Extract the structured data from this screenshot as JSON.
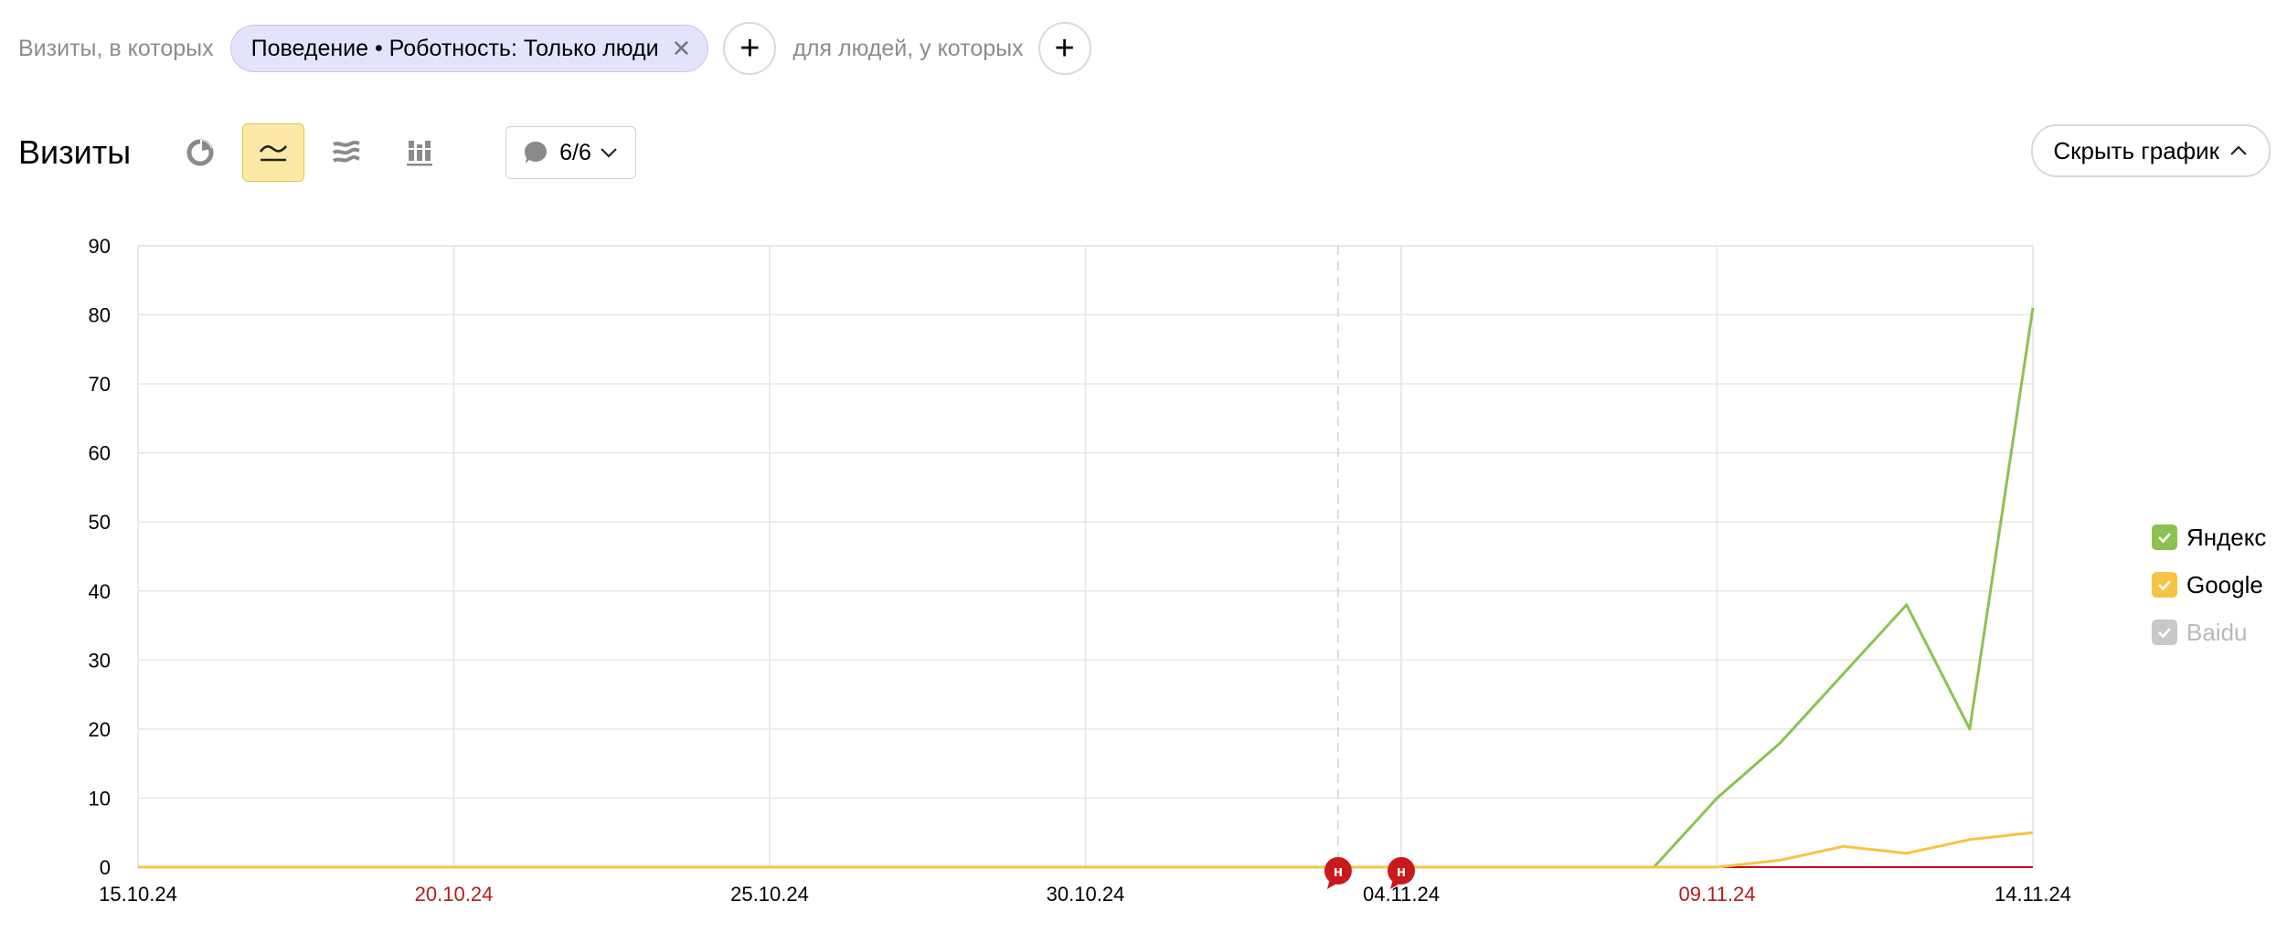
{
  "filters": {
    "visits_label": "Визиты, в которых",
    "chip_label": "Поведение • Роботность: Только люди",
    "add_symbol": "+",
    "people_label": "для людей, у которых"
  },
  "toolbar": {
    "title": "Визиты",
    "annotations_label": "6/6",
    "hide_chart_label": "Скрыть график"
  },
  "colors": {
    "yandex": "#8cc152",
    "google": "#f6c445",
    "baidu": "#c8c8c8",
    "axis_zero": "#d0021b",
    "holiday_label": "#b31b1b",
    "marker": "#c8191d"
  },
  "chart_data": {
    "type": "line",
    "x_ticks": [
      "15.10.24",
      "20.10.24",
      "25.10.24",
      "30.10.24",
      "04.11.24",
      "09.11.24",
      "14.11.24"
    ],
    "x_tick_holiday": [
      false,
      true,
      false,
      false,
      false,
      true,
      false
    ],
    "x_start": "15.10.24",
    "x_end": "14.11.24",
    "ylim": [
      0,
      90
    ],
    "y_ticks": [
      0,
      10,
      20,
      30,
      40,
      50,
      60,
      70,
      80,
      90
    ],
    "grid": true,
    "legend_position": "right",
    "series": [
      {
        "name": "Яндекс",
        "color_key": "yandex",
        "enabled": true,
        "points": [
          [
            "15.10.24",
            0
          ],
          [
            "08.11.24",
            0
          ],
          [
            "09.11.24",
            10
          ],
          [
            "10.11.24",
            18
          ],
          [
            "11.11.24",
            28
          ],
          [
            "12.11.24",
            38
          ],
          [
            "13.11.24",
            20
          ],
          [
            "14.11.24",
            81
          ]
        ]
      },
      {
        "name": "Google",
        "color_key": "google",
        "enabled": true,
        "points": [
          [
            "15.10.24",
            0
          ],
          [
            "09.11.24",
            0
          ],
          [
            "10.11.24",
            1
          ],
          [
            "11.11.24",
            3
          ],
          [
            "12.11.24",
            2
          ],
          [
            "13.11.24",
            4
          ],
          [
            "14.11.24",
            5
          ]
        ]
      },
      {
        "name": "Baidu",
        "color_key": "baidu",
        "enabled": false,
        "points": []
      }
    ],
    "annotations": [
      {
        "date": "03.11.24",
        "label": "н"
      },
      {
        "date": "04.11.24",
        "label": "н"
      }
    ],
    "dashed_line_date": "03.11.24"
  }
}
